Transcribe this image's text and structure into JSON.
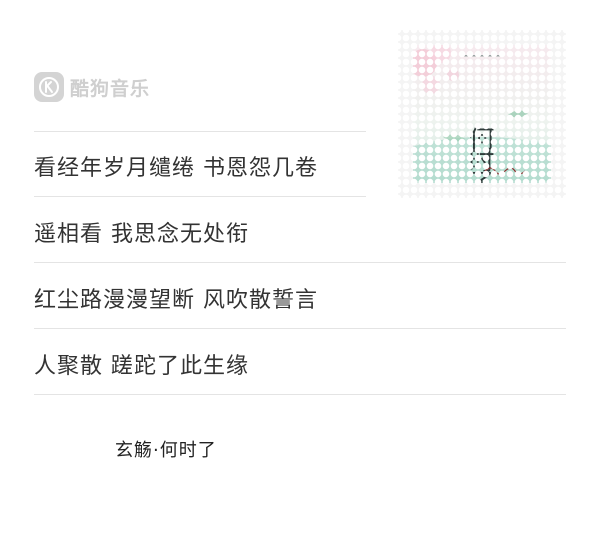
{
  "brand": {
    "name": "酷狗音乐",
    "icon": "kugou-logo-icon",
    "color": "#cfcfcf"
  },
  "lyrics": [
    "看经年岁月缱绻 书恩怨几卷",
    "遥相看 我思念无处衔",
    "红尘路漫漫望断 风吹散誓言",
    "人聚散 蹉跎了此生缘"
  ],
  "album": {
    "cover_title": "何时了",
    "icon": "album-cover-stamp"
  },
  "credit": {
    "text": "玄觞·何时了"
  }
}
